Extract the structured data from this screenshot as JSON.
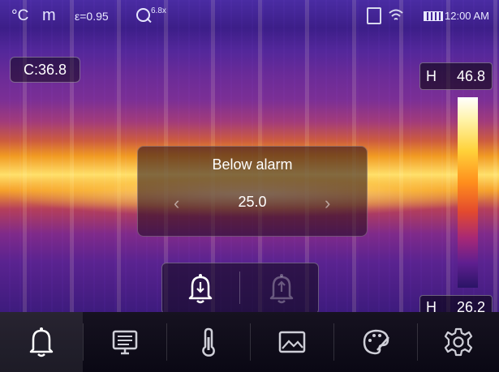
{
  "status_bar": {
    "unit": "°C",
    "distance_unit": "m",
    "emissivity": "ε=0.95",
    "zoom": "6.8x",
    "time": "12:00 AM",
    "icons": [
      "zoom-icon",
      "sd-card-icon",
      "wifi-icon",
      "battery-icon"
    ]
  },
  "center_temp": {
    "label": "C:",
    "value": "36.8"
  },
  "scale": {
    "high_label": "H",
    "high_value": "46.8",
    "low_label": "H",
    "low_value": "26.2"
  },
  "alarm_dialog": {
    "title": "Below alarm",
    "value": "25.0",
    "prev_icon": "chevron-left-icon",
    "next_icon": "chevron-right-icon"
  },
  "alarm_modes": [
    {
      "name": "below-alarm",
      "icon": "bell-down-icon",
      "selected": true
    },
    {
      "name": "above-alarm",
      "icon": "bell-up-icon",
      "selected": false
    }
  ],
  "menu": [
    {
      "icon": "bell-icon",
      "selected": true
    },
    {
      "icon": "monitor-icon",
      "selected": false
    },
    {
      "icon": "thermometer-icon",
      "selected": false
    },
    {
      "icon": "image-icon",
      "selected": false
    },
    {
      "icon": "palette-icon",
      "selected": false
    },
    {
      "icon": "gear-icon",
      "selected": false
    }
  ],
  "colors": {
    "accent": "#ffffff",
    "scale_hot": "#ffffff",
    "scale_cold": "#2a1466"
  }
}
